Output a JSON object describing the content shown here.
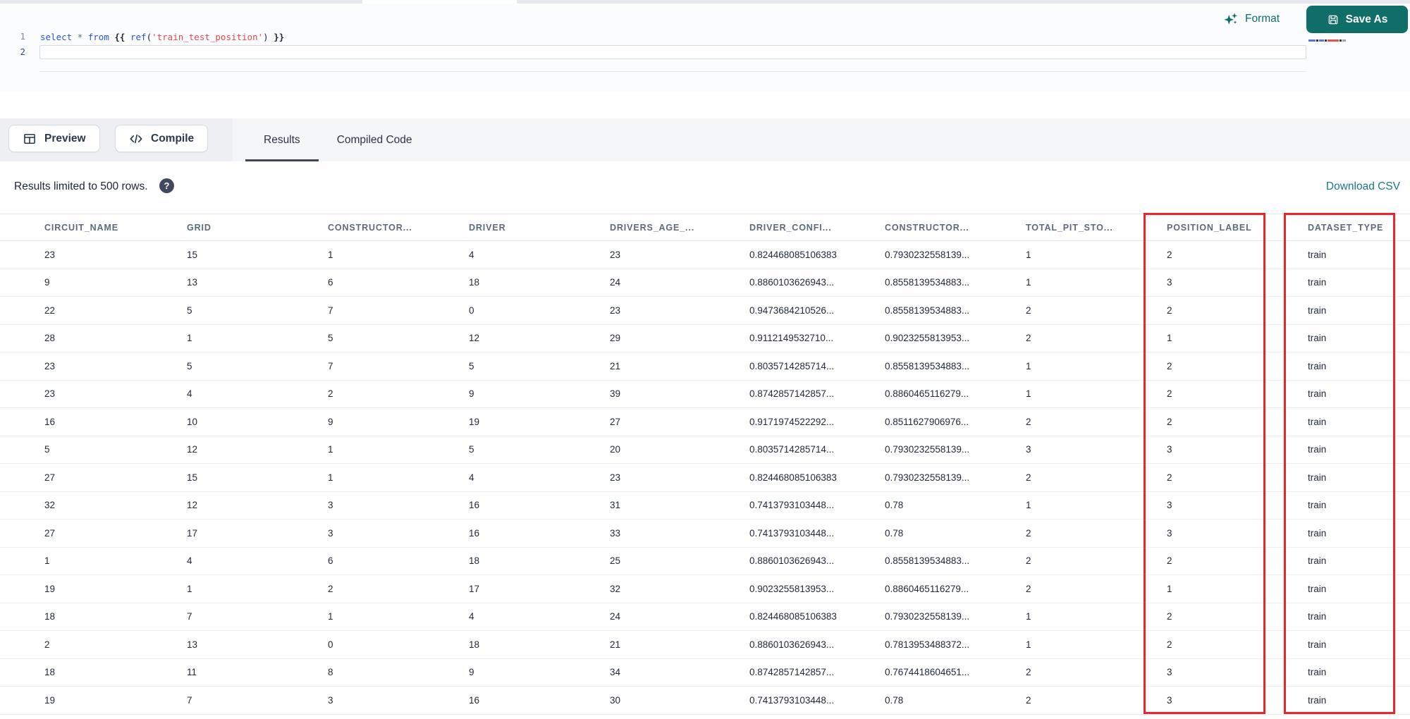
{
  "top_bar": {
    "format_label": "Format",
    "save_as_label": "Save As"
  },
  "editor": {
    "line_numbers": [
      "1",
      "2"
    ],
    "code_tokens": [
      {
        "text": "select",
        "type": "kw"
      },
      {
        "text": " ",
        "type": "plain"
      },
      {
        "text": "*",
        "type": "star"
      },
      {
        "text": " ",
        "type": "plain"
      },
      {
        "text": "from",
        "type": "kw"
      },
      {
        "text": " ",
        "type": "plain"
      },
      {
        "text": "{{",
        "type": "brace"
      },
      {
        "text": " ",
        "type": "plain"
      },
      {
        "text": "ref",
        "type": "fn"
      },
      {
        "text": "(",
        "type": "paren"
      },
      {
        "text": "'train_test_position'",
        "type": "str"
      },
      {
        "text": ")",
        "type": "paren"
      },
      {
        "text": " ",
        "type": "plain"
      },
      {
        "text": "}}",
        "type": "brace"
      }
    ]
  },
  "actions": {
    "preview_label": "Preview",
    "compile_label": "Compile"
  },
  "tabs": [
    {
      "label": "Results",
      "active": true
    },
    {
      "label": "Compiled Code",
      "active": false
    }
  ],
  "results_bar": {
    "info_text": "Results limited to 500 rows.",
    "help_glyph": "?",
    "download_label": "Download CSV"
  },
  "table": {
    "columns": [
      "CIRCUIT_NAME",
      "GRID",
      "CONSTRUCTOR...",
      "DRIVER",
      "DRIVERS_AGE_...",
      "DRIVER_CONFI...",
      "CONSTRUCTOR...",
      "TOTAL_PIT_STO...",
      "POSITION_LABEL",
      "DATASET_TYPE"
    ],
    "rows": [
      [
        "23",
        "15",
        "1",
        "4",
        "23",
        "0.824468085106383",
        "0.7930232558139...",
        "1",
        "2",
        "train"
      ],
      [
        "9",
        "13",
        "6",
        "18",
        "24",
        "0.8860103626943...",
        "0.8558139534883...",
        "1",
        "3",
        "train"
      ],
      [
        "22",
        "5",
        "7",
        "0",
        "23",
        "0.9473684210526...",
        "0.8558139534883...",
        "2",
        "2",
        "train"
      ],
      [
        "28",
        "1",
        "5",
        "12",
        "29",
        "0.9112149532710...",
        "0.9023255813953...",
        "2",
        "1",
        "train"
      ],
      [
        "23",
        "5",
        "7",
        "5",
        "21",
        "0.8035714285714...",
        "0.8558139534883...",
        "1",
        "2",
        "train"
      ],
      [
        "23",
        "4",
        "2",
        "9",
        "39",
        "0.8742857142857...",
        "0.8860465116279...",
        "1",
        "2",
        "train"
      ],
      [
        "16",
        "10",
        "9",
        "19",
        "27",
        "0.9171974522292...",
        "0.8511627906976...",
        "2",
        "2",
        "train"
      ],
      [
        "5",
        "12",
        "1",
        "5",
        "20",
        "0.8035714285714...",
        "0.7930232558139...",
        "3",
        "3",
        "train"
      ],
      [
        "27",
        "15",
        "1",
        "4",
        "23",
        "0.824468085106383",
        "0.7930232558139...",
        "2",
        "2",
        "train"
      ],
      [
        "32",
        "12",
        "3",
        "16",
        "31",
        "0.7413793103448...",
        "0.78",
        "1",
        "3",
        "train"
      ],
      [
        "27",
        "17",
        "3",
        "16",
        "33",
        "0.7413793103448...",
        "0.78",
        "2",
        "3",
        "train"
      ],
      [
        "1",
        "4",
        "6",
        "18",
        "25",
        "0.8860103626943...",
        "0.8558139534883...",
        "2",
        "2",
        "train"
      ],
      [
        "19",
        "1",
        "2",
        "17",
        "32",
        "0.9023255813953...",
        "0.8860465116279...",
        "2",
        "1",
        "train"
      ],
      [
        "18",
        "7",
        "1",
        "4",
        "24",
        "0.824468085106383",
        "0.7930232558139...",
        "1",
        "2",
        "train"
      ],
      [
        "2",
        "13",
        "0",
        "18",
        "21",
        "0.8860103626943...",
        "0.7813953488372...",
        "1",
        "2",
        "train"
      ],
      [
        "18",
        "11",
        "8",
        "9",
        "34",
        "0.8742857142857...",
        "0.7674418604651...",
        "2",
        "3",
        "train"
      ],
      [
        "19",
        "7",
        "3",
        "16",
        "30",
        "0.7413793103448...",
        "0.78",
        "2",
        "3",
        "train"
      ]
    ]
  },
  "annotations": {
    "highlight_color": "#ee2428",
    "highlighted_columns": [
      "POSITION_LABEL",
      "DATASET_TYPE"
    ]
  },
  "colors": {
    "accent_teal": "#0f6e68",
    "link_teal": "#17798a"
  }
}
